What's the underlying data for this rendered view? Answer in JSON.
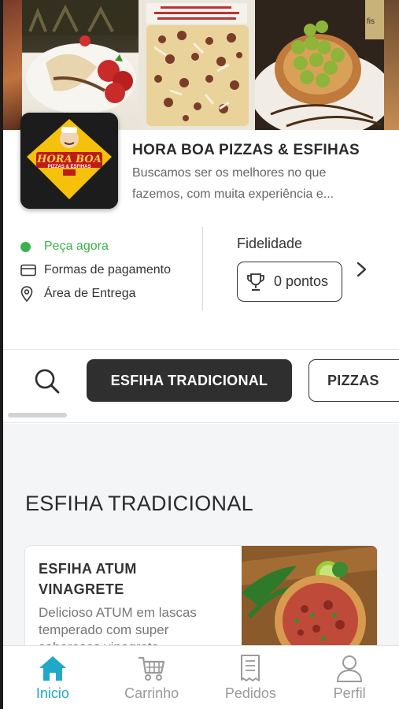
{
  "store": {
    "name": "HORA BOA PIZZAS & ESFIHAS",
    "description_line1": "Buscamos ser os melhores no que",
    "description_line2": "fazemos, com muita experiência e...",
    "logo_text_top": "HORA BOA",
    "logo_text_bottom": "PIZZAS & ESFIHAS"
  },
  "info": {
    "status": "Peça agora",
    "payment": "Formas de pagamento",
    "delivery": "Área de Entrega",
    "status_color": "#38b24a"
  },
  "loyalty": {
    "title": "Fidelidade",
    "points": "0 pontos"
  },
  "categories": {
    "active": "ESFIHA TRADICIONAL",
    "next": "PIZZAS"
  },
  "section": {
    "title": "ESFIHA TRADICIONAL"
  },
  "product": {
    "name_line1": "ESFIHA ATUM",
    "name_line2": "VINAGRETE",
    "desc_line1": "Delicioso ATUM em lascas",
    "desc_line2": "temperado com super",
    "desc_line3": "saborosos vinagrete..."
  },
  "nav": {
    "home": "Inicio",
    "cart": "Carrinho",
    "orders": "Pedidos",
    "profile": "Perfil",
    "active_color": "#1fa9c9"
  },
  "icons": [
    "home-icon",
    "cart-icon",
    "receipt-icon",
    "user-icon",
    "search-icon",
    "trophy-icon",
    "chevron-right-icon",
    "credit-card-icon",
    "map-pin-icon"
  ]
}
